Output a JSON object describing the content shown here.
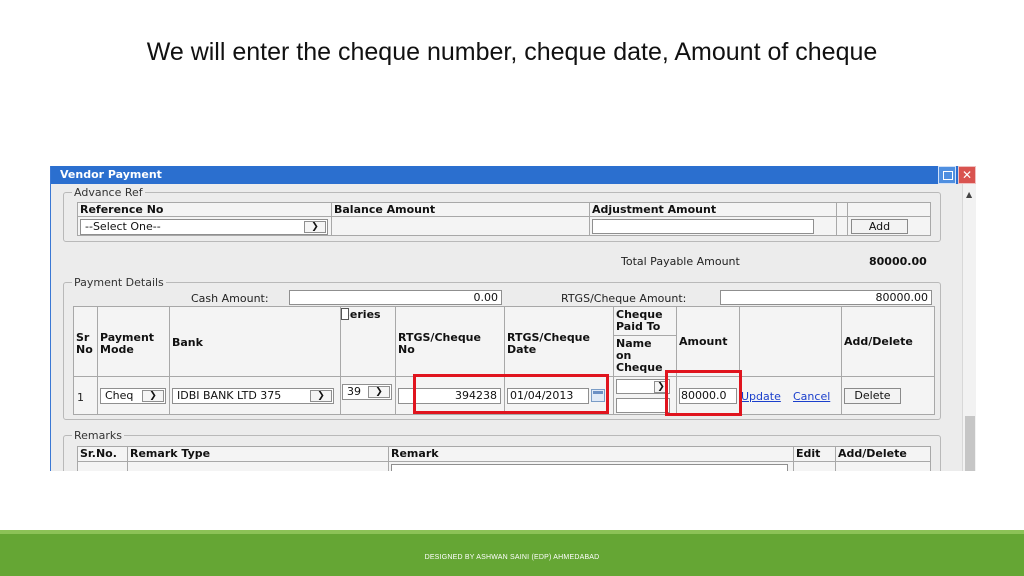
{
  "slide": {
    "title": "We will enter the cheque number, cheque date, Amount of cheque",
    "footer": "DESIGNED BY ASHWAN SAINI (EDP) AHMEDABAD"
  },
  "window": {
    "title": "Vendor Payment",
    "close_glyph": "✕"
  },
  "advance_ref": {
    "legend": "Advance Ref",
    "col_reference_no": "Reference No",
    "col_balance_amount": "Balance Amount",
    "col_adjustment_amount": "Adjustment Amount",
    "reference_select_value": "--Select One--",
    "add_label": "Add"
  },
  "total": {
    "label": "Total Payable Amount",
    "value": "80000.00"
  },
  "payment_details": {
    "legend": "Payment Details",
    "cash_label": "Cash Amount:",
    "cash_value": "0.00",
    "rtgs_label": "RTGS/Cheque Amount:",
    "rtgs_value": "80000.00",
    "headers": {
      "sr_no_1": "Sr",
      "sr_no_2": "No",
      "payment_mode_1": "Payment",
      "payment_mode_2": "Mode",
      "bank": "Bank",
      "series": "Series",
      "rtgs_no_1": "RTGS/Cheque",
      "rtgs_no_2": "No",
      "rtgs_date_1": "RTGS/Cheque",
      "rtgs_date_2": "Date",
      "paid_to_1": "Cheque",
      "paid_to_2": "Paid To",
      "name_on_1": "Name",
      "name_on_2": "on",
      "name_on_3": "Cheque",
      "amount": "Amount",
      "add_delete": "Add/Delete"
    },
    "row": {
      "sr": "1",
      "payment_mode": "Cheq",
      "bank": "IDBI BANK LTD 375",
      "series": "39",
      "cheque_no": "394238",
      "cheque_date": "01/04/2013",
      "paid_to": "",
      "name_on_cheque": "",
      "amount": "80000.0",
      "update_link": "Update",
      "cancel_link": "Cancel",
      "delete_label": "Delete"
    }
  },
  "remarks": {
    "legend": "Remarks",
    "col_sr": "Sr.No.",
    "col_type": "Remark Type",
    "col_remark": "Remark",
    "col_edit": "Edit",
    "col_add_delete": "Add/Delete"
  },
  "colors": {
    "titlebar": "#2b6fcf",
    "highlight": "#e0141e",
    "footer_band": "#65a634",
    "link": "#1a3fcc"
  }
}
